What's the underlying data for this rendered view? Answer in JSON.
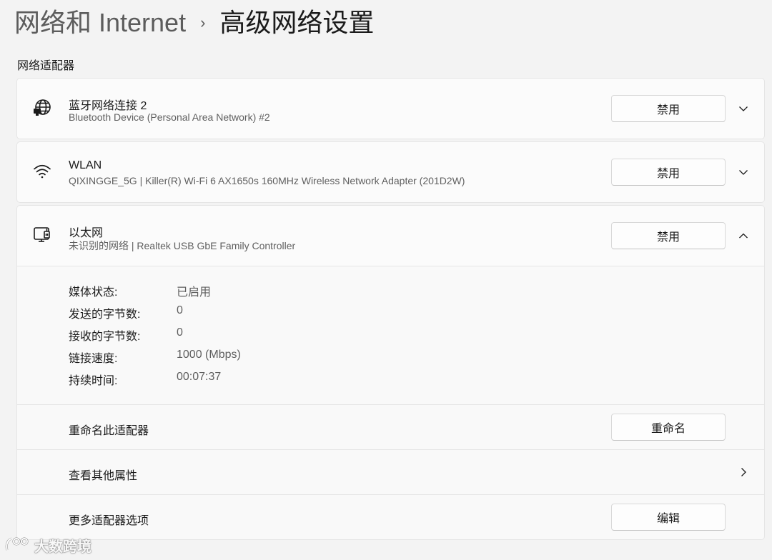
{
  "header": {
    "parent": "网络和 Internet",
    "separator": "›",
    "current": "高级网络设置"
  },
  "section": {
    "title": "网络适配器"
  },
  "adapters": [
    {
      "icon": "globe-network-icon",
      "name": "蓝牙网络连接 2",
      "description": "Bluetooth Device (Personal Area Network) #2",
      "button_label": "禁用",
      "expanded": false
    },
    {
      "icon": "wifi-icon",
      "name": "WLAN",
      "description": "QIXINGGE_5G | Killer(R) Wi-Fi 6 AX1650s 160MHz Wireless Network Adapter (201D2W)",
      "button_label": "禁用",
      "expanded": false
    },
    {
      "icon": "ethernet-icon",
      "name": "以太网",
      "description": "未识别的网络 | Realtek USB GbE Family Controller",
      "button_label": "禁用",
      "expanded": true,
      "details": [
        {
          "label": "媒体状态:",
          "value": "已启用"
        },
        {
          "label": "发送的字节数:",
          "value": "0"
        },
        {
          "label": "接收的字节数:",
          "value": "0"
        },
        {
          "label": "链接速度:",
          "value": "1000 (Mbps)"
        },
        {
          "label": "持续时间:",
          "value": "00:07:37"
        }
      ],
      "actions": [
        {
          "label": "重命名此适配器",
          "button_label": "重命名"
        },
        {
          "label": "查看其他属性"
        },
        {
          "label": "更多适配器选项",
          "button_label": "编辑"
        }
      ]
    }
  ],
  "watermark": {
    "text": "大数跨境"
  }
}
